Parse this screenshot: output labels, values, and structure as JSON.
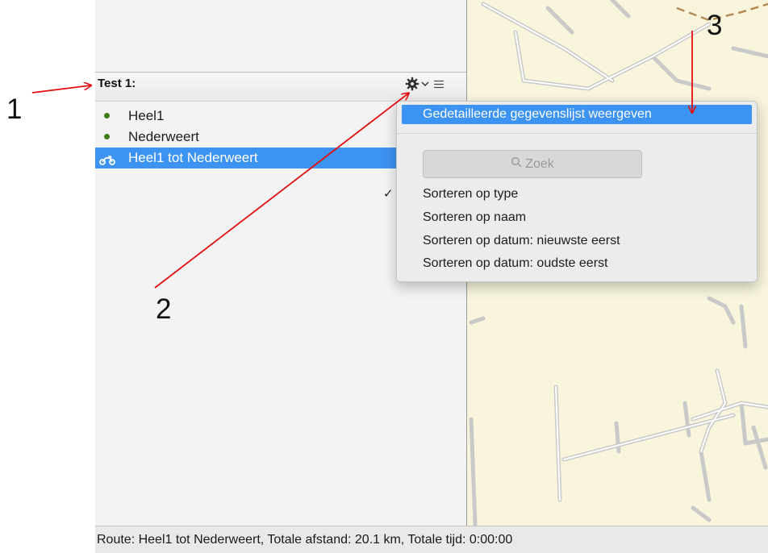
{
  "list_header": {
    "title": "Test 1:",
    "gear_icon": "gear-icon",
    "chevron_icon": "chevron-down-icon",
    "list_icon": "list-icon"
  },
  "list_items": [
    {
      "label": "Heel1",
      "icon": "waypoint-dot-icon"
    },
    {
      "label": "Nederweert",
      "icon": "waypoint-dot-icon"
    },
    {
      "label": "Heel1 tot Nederweert",
      "icon": "motorcycle-icon",
      "selected": true
    }
  ],
  "menu": {
    "top_item": "Gedetailleerde gegevenslijst weergeven",
    "search_placeholder": "Zoek",
    "sort_items": [
      "Sorteren op type",
      "Sorteren op naam",
      "Sorteren op datum: nieuwste eerst",
      "Sorteren op datum: oudste eerst"
    ],
    "checked_item": "Sorteren op type",
    "checkmark": "✓"
  },
  "status_bar": {
    "text": "Route: Heel1 tot Nederweert, Totale afstand: 20.1 km, Totale tijd: 0:00:00"
  },
  "annotations": [
    "1",
    "2",
    "3"
  ],
  "colors": {
    "selection": "#3d93f1",
    "map_background": "#f8f5dc",
    "annotation_arrow": "#e01010",
    "waypoint_dot": "#3e7d1a"
  }
}
